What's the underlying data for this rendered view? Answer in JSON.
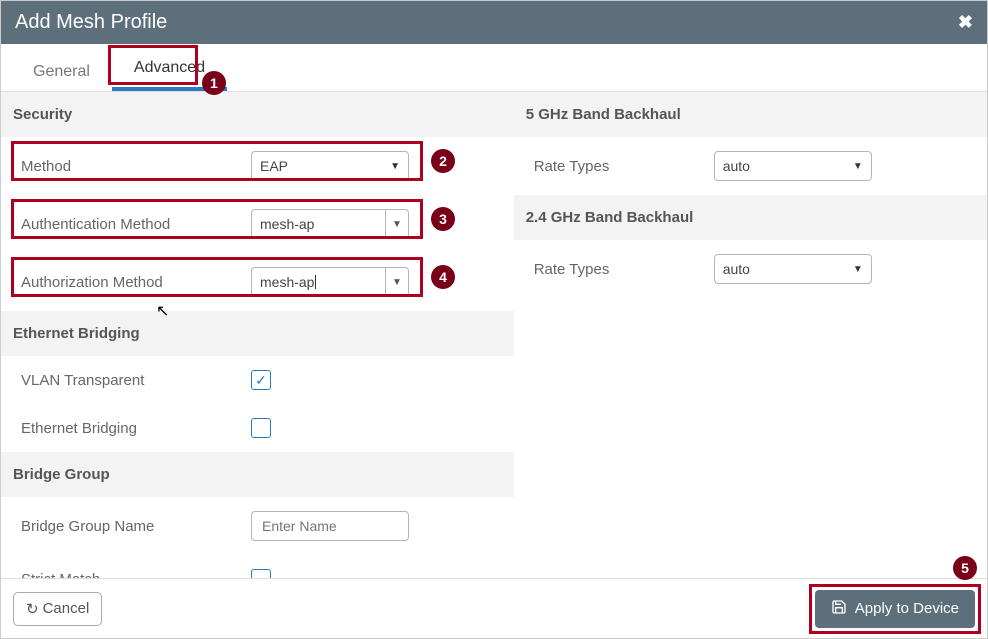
{
  "title": "Add Mesh Profile",
  "tabs": {
    "general": "General",
    "advanced": "Advanced",
    "active": "advanced"
  },
  "callouts": {
    "c1": "1",
    "c2": "2",
    "c3": "3",
    "c4": "4",
    "c5": "5"
  },
  "security": {
    "header": "Security",
    "method_label": "Method",
    "method_value": "EAP",
    "authn_label": "Authentication Method",
    "authn_value": "mesh-ap",
    "authz_label": "Authorization Method",
    "authz_value": "mesh-ap"
  },
  "ethernet_bridging": {
    "header": "Ethernet Bridging",
    "vlan_label": "VLAN Transparent",
    "vlan_checked": true,
    "eb_label": "Ethernet Bridging",
    "eb_checked": false
  },
  "bridge_group": {
    "header": "Bridge Group",
    "name_label": "Bridge Group Name",
    "name_placeholder": "Enter Name",
    "strict_label": "Strict Match",
    "strict_checked": false
  },
  "backhaul5": {
    "header": "5 GHz Band Backhaul",
    "rate_label": "Rate Types",
    "rate_value": "auto"
  },
  "backhaul24": {
    "header": "2.4 GHz Band Backhaul",
    "rate_label": "Rate Types",
    "rate_value": "auto"
  },
  "footer": {
    "cancel": "Cancel",
    "apply": "Apply to Device"
  }
}
